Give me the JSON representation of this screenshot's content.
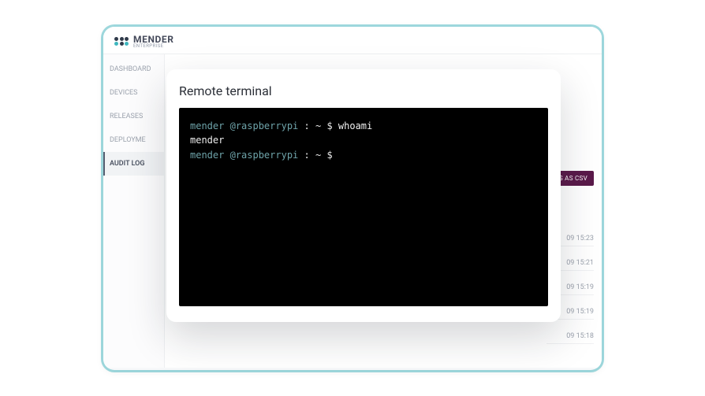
{
  "brand": {
    "name": "MENDER",
    "edition": "ENTERPRISE"
  },
  "sidebar": {
    "items": [
      {
        "label": "DASHBOARD"
      },
      {
        "label": "DEVICES"
      },
      {
        "label": "RELEASES"
      },
      {
        "label": "DEPLOYME"
      },
      {
        "label": "AUDIT LOG"
      }
    ],
    "active_index": 4
  },
  "main": {
    "export_button": "RESULTS AS CSV",
    "timestamps": [
      "09 15:23",
      "09 15:21",
      "09 15:19",
      "09 15:19",
      "09 15:18"
    ]
  },
  "modal": {
    "title": "Remote terminal",
    "terminal": {
      "lines": [
        {
          "type": "prompt",
          "user_host": "mender @raspberrypi",
          "path": "~",
          "symbol": "$",
          "command": "whoami"
        },
        {
          "type": "output",
          "text": "mender"
        },
        {
          "type": "prompt",
          "user_host": "mender @raspberrypi",
          "path": "~",
          "symbol": "$",
          "command": ""
        }
      ]
    }
  }
}
